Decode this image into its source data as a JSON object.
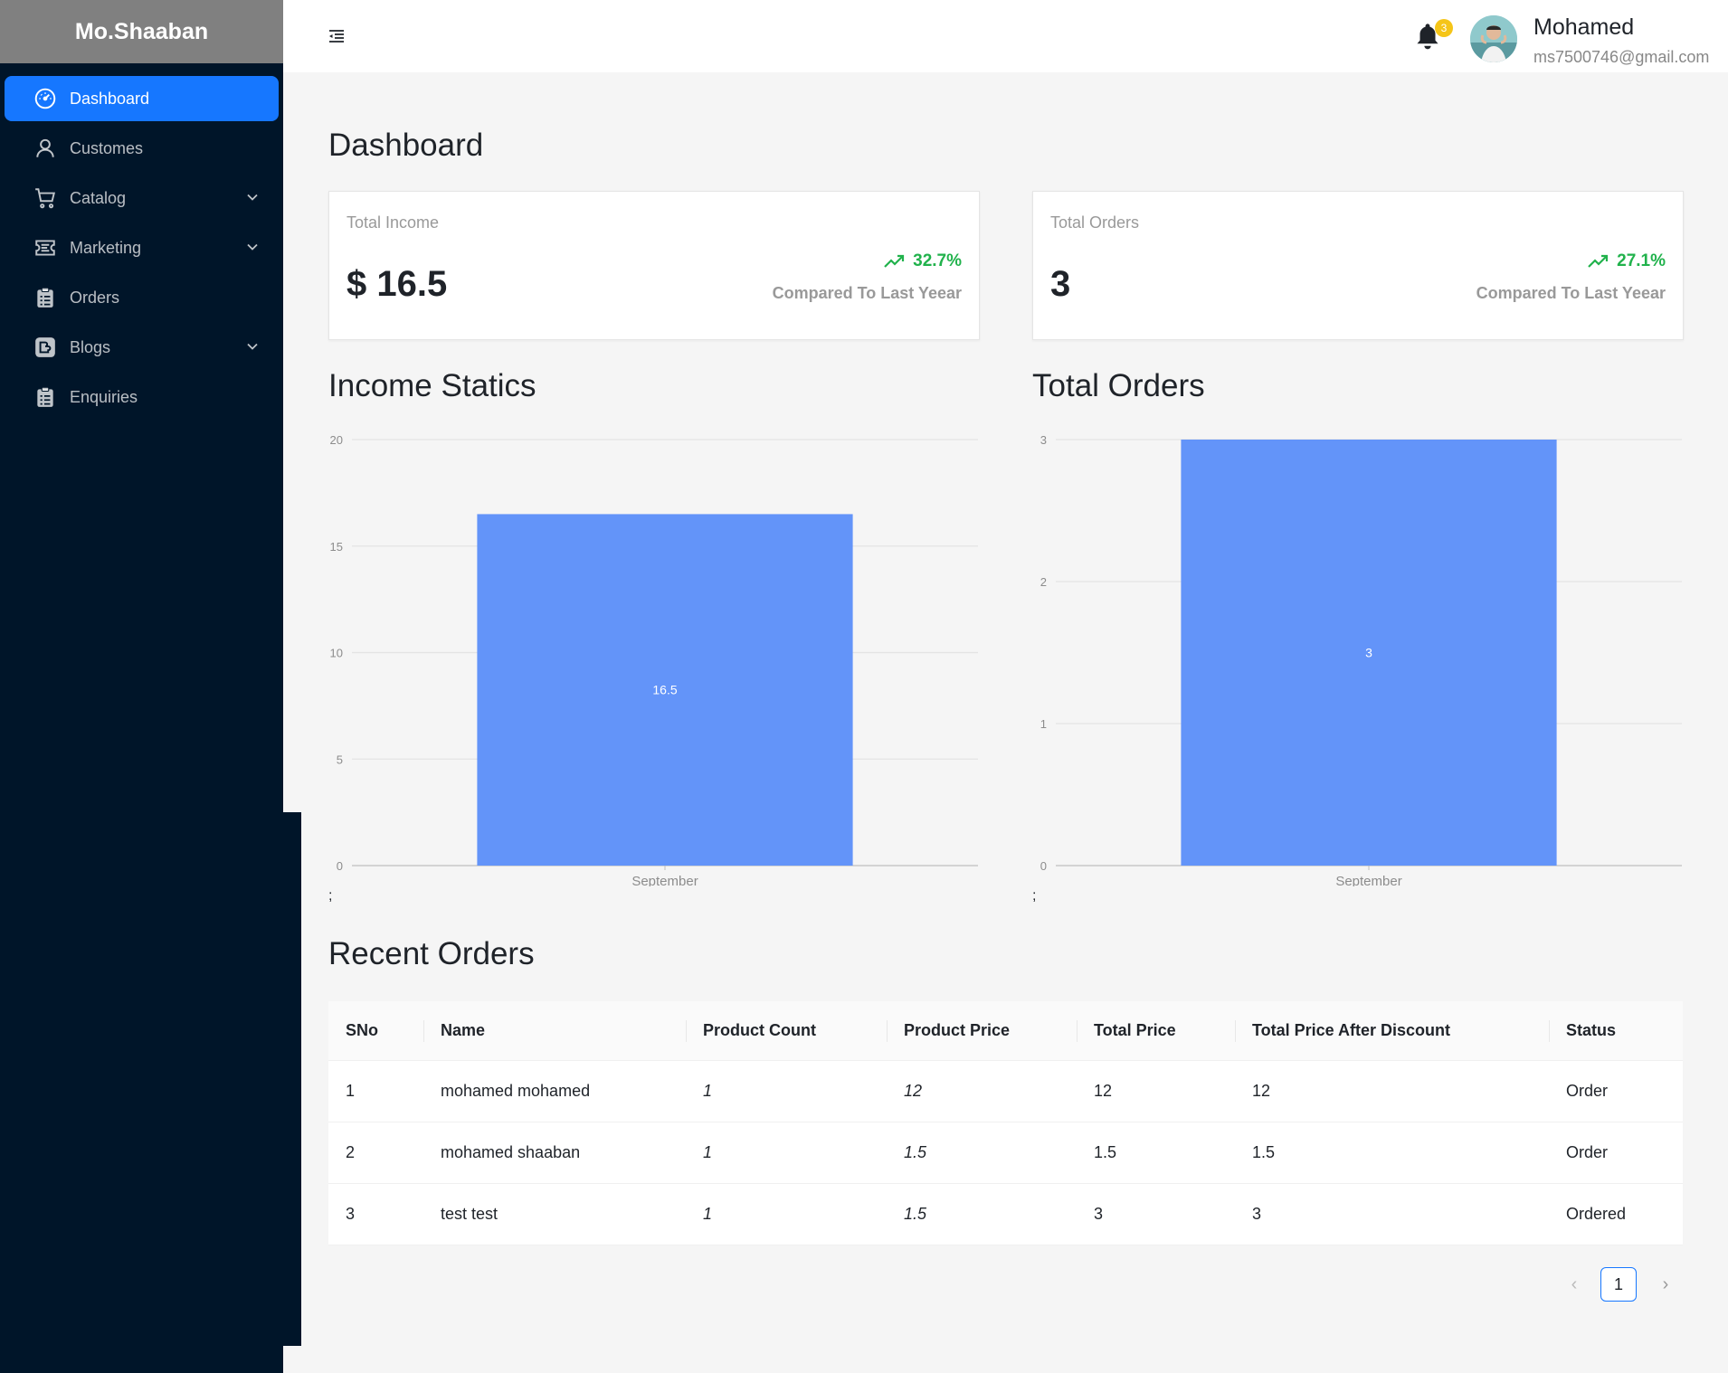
{
  "brand": "Mo.Shaaban",
  "sidebar": {
    "items": [
      {
        "label": "Dashboard",
        "active": true
      },
      {
        "label": "Customes"
      },
      {
        "label": "Catalog",
        "expandable": true
      },
      {
        "label": "Marketing",
        "expandable": true
      },
      {
        "label": "Orders"
      },
      {
        "label": "Blogs",
        "expandable": true
      },
      {
        "label": "Enquiries"
      }
    ]
  },
  "header": {
    "notifications_count": "3",
    "user_name": "Mohamed",
    "user_email": "ms7500746@gmail.com"
  },
  "page_title": "Dashboard",
  "stats": [
    {
      "label": "Total Income",
      "value": "$ 16.5",
      "trend": "32.7%",
      "compare": "Compared To Last Yeear"
    },
    {
      "label": "Total Orders",
      "value": "3",
      "trend": "27.1%",
      "compare": "Compared To Last Yeear"
    }
  ],
  "chart_titles": [
    "Income Statics",
    "Total Orders"
  ],
  "chart_footers": [
    ";",
    ";"
  ],
  "chart_data": [
    {
      "type": "bar",
      "categories": [
        "September"
      ],
      "values": [
        16.5
      ],
      "data_labels": [
        "16.5"
      ],
      "yticks": [
        "0",
        "5",
        "10",
        "15",
        "20"
      ],
      "ylim": [
        0,
        20
      ],
      "grid": true,
      "color": "#6394f9"
    },
    {
      "type": "bar",
      "categories": [
        "September"
      ],
      "values": [
        3
      ],
      "data_labels": [
        "3"
      ],
      "yticks": [
        "0",
        "1",
        "2",
        "3"
      ],
      "ylim": [
        0,
        3
      ],
      "grid": true,
      "color": "#6394f9"
    }
  ],
  "recent_orders": {
    "title": "Recent Orders",
    "columns": [
      "SNo",
      "Name",
      "Product Count",
      "Product Price",
      "Total Price",
      "Total Price After Discount",
      "Status"
    ],
    "rows": [
      [
        "1",
        "mohamed mohamed",
        "1",
        "12",
        "12",
        "12",
        "Order"
      ],
      [
        "2",
        "mohamed shaaban",
        "1",
        "1.5",
        "1.5",
        "1.5",
        "Order"
      ],
      [
        "3",
        "test test",
        "1",
        "1.5",
        "3",
        "3",
        "Ordered"
      ]
    ]
  },
  "pagination": {
    "current": "1",
    "prev": "‹",
    "next": "›"
  },
  "colors": {
    "sidebar": "#001529",
    "accent": "#1677ff",
    "trend_up": "#21b24c",
    "bar": "#6394f9"
  }
}
